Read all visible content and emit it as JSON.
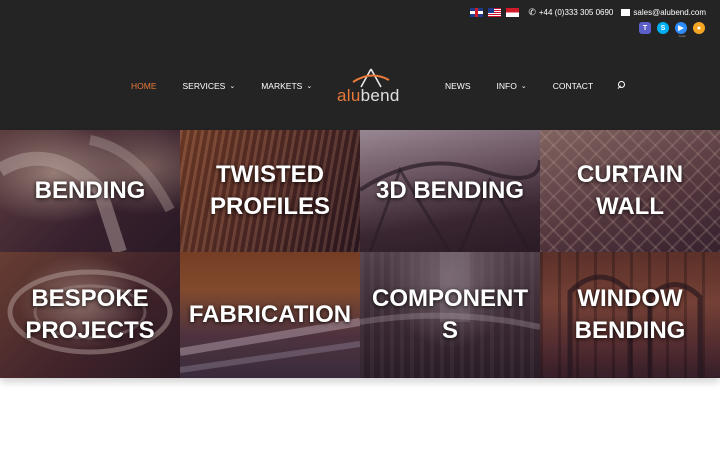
{
  "topbar": {
    "flags": [
      "uk-flag-icon",
      "us-flag-icon",
      "singapore-flag-icon"
    ],
    "phone": "+44 (0)333 305 0690",
    "email": "sales@alubend.com"
  },
  "apps": [
    "teams-icon",
    "skype-icon",
    "zoom-icon",
    "other-app-icon"
  ],
  "app_labels": [
    "zoom"
  ],
  "nav": {
    "left": [
      {
        "label": "HOME",
        "dropdown": false,
        "active": true
      },
      {
        "label": "SERVICES",
        "dropdown": true
      },
      {
        "label": "MARKETS",
        "dropdown": true
      }
    ],
    "right": [
      {
        "label": "NEWS",
        "dropdown": false
      },
      {
        "label": "INFO",
        "dropdown": true
      },
      {
        "label": "CONTACT",
        "dropdown": false
      }
    ]
  },
  "logo": {
    "part1": "alu",
    "part2": "bend"
  },
  "tiles": [
    {
      "line1": "BENDING",
      "line2": ""
    },
    {
      "line1": "TWISTED",
      "line2": "PROFILES"
    },
    {
      "line1": "3D BENDING",
      "line2": ""
    },
    {
      "line1": "CURTAIN",
      "line2": "WALL"
    },
    {
      "line1": "BESPOKE",
      "line2": "PROJECTS"
    },
    {
      "line1": "FABRICATION",
      "line2": ""
    },
    {
      "line1": "COMPONENT",
      "line2": "S"
    },
    {
      "line1": "WINDOW",
      "line2": "BENDING"
    }
  ],
  "colors": {
    "header_bg": "#242424",
    "accent": "#e8793a",
    "nav_text": "#ffffff"
  }
}
